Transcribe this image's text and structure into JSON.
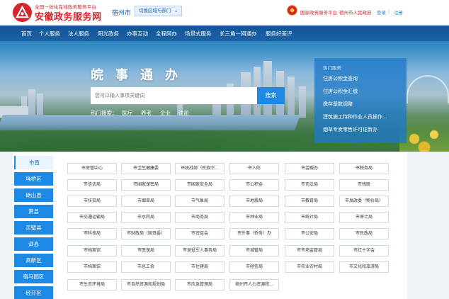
{
  "header": {
    "brand_sub": "全国一体化在线政务服务平台",
    "brand_main": "安徽政务服务网",
    "city": "宿州市",
    "city_switch": "切换区域与部门",
    "gov_link": "国家政务服务平台",
    "city_gov": "宿州市人民政府",
    "login": "登录",
    "separator": "|",
    "register": "注册",
    "brand_color": "#d8232a",
    "accent_color": "#1e88e5"
  },
  "nav": [
    "首页",
    "个人服务",
    "法人服务",
    "阳光政务",
    "办事互动",
    "全程网办",
    "场景式服务",
    "长三角一网通办",
    "服务好差评"
  ],
  "hero": {
    "slogan": "皖事通办",
    "search_placeholder": "您可以输入事项关键词",
    "search_button": "搜索",
    "hot_label": "热门搜索：",
    "hot_items": [
      "医疗",
      "养老",
      "企业",
      "注册"
    ]
  },
  "hot_services": {
    "title": "热门服务",
    "items": [
      "住房公积金查询",
      "住房公积金汇缴",
      "缴存基数调整",
      "建筑施工特种作业人员操作...",
      "烟草专卖零售许可证新办"
    ]
  },
  "regions": [
    "市直",
    "埇桥区",
    "砀山县",
    "萧县",
    "灵璧县",
    "泗县",
    "高新区",
    "宿马园区",
    "经开区"
  ],
  "departments": [
    "市房管中心",
    "市卫生健康委",
    "市统战部（民族宗...",
    "市人防",
    "市金融办",
    "市税务局",
    "市信访局",
    "市国家保密局",
    "市国家安全局",
    "市公积金",
    "市司法局",
    "市残联",
    "市扶贫局",
    "市烟草局",
    "市气象局",
    "市地震局",
    "市教育局",
    "市发改委（物价局）",
    "市交通运输局",
    "市水利局",
    "市商务局",
    "市林业局",
    "市统计局",
    "市审计局",
    "市科技局",
    "市财政局（国资委）",
    "市贸促会",
    "市外事（侨务）办",
    "市公安局",
    "市民政局",
    "市档案馆",
    "市医保局",
    "市退役军人事务局",
    "市城管局",
    "市市场监管局",
    "市红十字会",
    "市档案馆",
    "市总工会",
    "市住建局",
    "市经信局",
    "市农业农村局",
    "市文化和旅游局",
    "市生态环境局",
    "市自然资源和规划局",
    "市应急管理局",
    "宿州市人力资源和..."
  ]
}
